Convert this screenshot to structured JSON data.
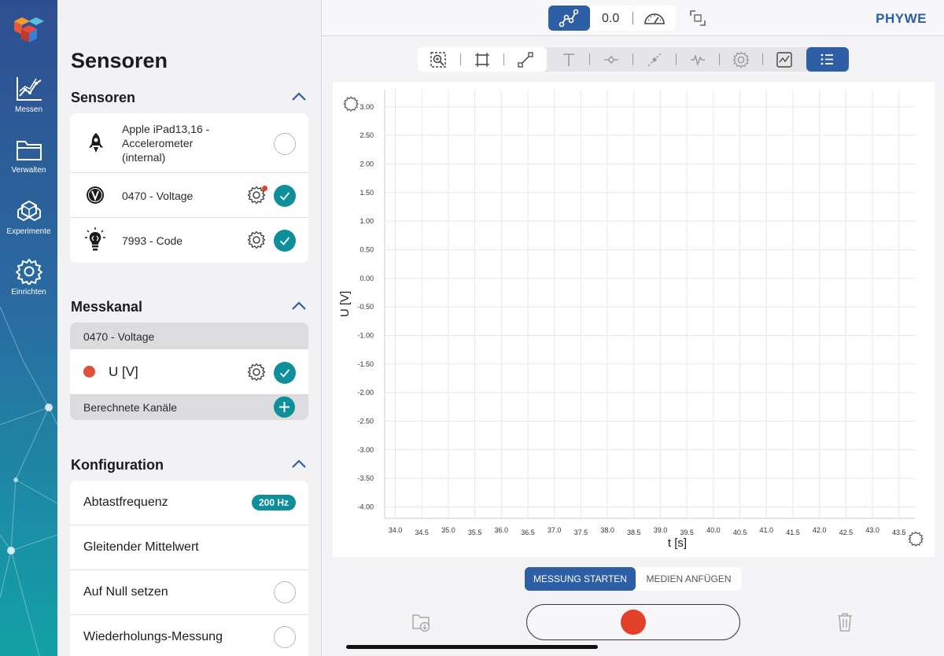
{
  "nav": {
    "items": [
      {
        "label": "Messen",
        "icon": "chart-line-icon"
      },
      {
        "label": "Verwalten",
        "icon": "folder-icon"
      },
      {
        "label": "Experimente",
        "icon": "cubes-icon"
      },
      {
        "label": "Einrichten",
        "icon": "gear-icon"
      }
    ]
  },
  "topbar": {
    "value": "0.0",
    "brand": "PHYWE"
  },
  "sidebar": {
    "title": "Sensoren",
    "sensors": {
      "heading": "Sensoren",
      "items": [
        {
          "name": "Apple iPad13,16 - Accelerometer (internal)",
          "line1": "Apple iPad13,16 -",
          "line2": "Accelerometer",
          "line3": "(internal)",
          "icon": "rocket-icon",
          "selected": false
        },
        {
          "name": "0470 - Voltage",
          "icon": "voltage-icon",
          "selected": true
        },
        {
          "name": "7993 - Code",
          "icon": "code-bulb-icon",
          "selected": true
        }
      ]
    },
    "channel": {
      "heading": "Messkanal",
      "group": "0470 - Voltage",
      "channel_name": "U [V]",
      "channel_color": "#e0503a",
      "computed": "Berechnete Kanäle"
    },
    "config": {
      "heading": "Konfiguration",
      "items": [
        {
          "label": "Abtastfrequenz",
          "badge": "200 Hz"
        },
        {
          "label": "Gleitender Mittelwert"
        },
        {
          "label": "Auf Null setzen"
        },
        {
          "label": "Wiederholungs-Messung"
        }
      ]
    }
  },
  "chart_data": {
    "type": "line",
    "xlabel": "t [s]",
    "ylabel": "U [V]",
    "xlim": [
      33.8,
      43.8
    ],
    "ylim": [
      -4.2,
      3.3
    ],
    "x_ticks": [
      "34.0",
      "34.5",
      "35.0",
      "35.5",
      "36.0",
      "36.5",
      "37.0",
      "37.5",
      "38.0",
      "38.5",
      "39.0",
      "39.5",
      "40.0",
      "40.5",
      "41.0",
      "41.5",
      "42.0",
      "42.5",
      "43.0",
      "43.5"
    ],
    "y_ticks": [
      "3.00",
      "2.50",
      "2.00",
      "1.50",
      "1.00",
      "0.50",
      "0.00",
      "-0.50",
      "-1.00",
      "-1.50",
      "-2.00",
      "-2.50",
      "-3.00",
      "-3.50",
      "-4.00"
    ],
    "series": [],
    "grid": true
  },
  "actions": {
    "start": "MESSUNG STARTEN",
    "media": "MEDIEN ANFÜGEN"
  }
}
